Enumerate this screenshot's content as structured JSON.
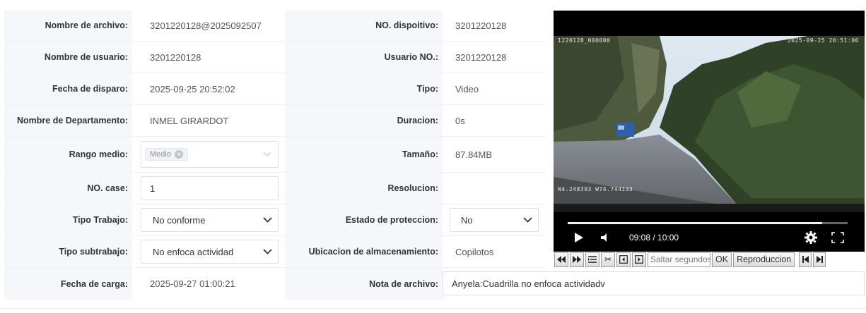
{
  "form": {
    "rows": [
      {
        "l_label": "Nombre de archivo:",
        "l_value": "3201220128@2025092507",
        "r_label": "NO. dispoitivo:",
        "r_value": "3201220128"
      },
      {
        "l_label": "Nombre de usuario:",
        "l_value": "3201220128",
        "r_label": "Usuario NO.:",
        "r_value": "3201220128"
      },
      {
        "l_label": "Fecha de disparo:",
        "l_value": "2025-09-25 20:52:02",
        "r_label": "Tipo:",
        "r_value": "Video"
      },
      {
        "l_label": "Nombre de Departamento:",
        "l_value": "INMEL GIRARDOT",
        "r_label": "Duracion:",
        "r_value": "0s"
      },
      {
        "l_label": "Rango medio:",
        "l_tag": "Medio",
        "r_label": "Tamaño:",
        "r_value": "87.84MB"
      },
      {
        "l_label": "NO. case:",
        "l_input": "1",
        "r_label": "Resolucion:",
        "r_value": ""
      },
      {
        "l_label": "Tipo Trabajo:",
        "l_select": "No conforme",
        "r_label": "Estado de proteccion:",
        "r_select": "No"
      },
      {
        "l_label": "Tipo subtrabajo:",
        "l_select": "No enfoca actividad",
        "r_label": "Ubicacion de almacenamiento:",
        "r_value": "Copilotos"
      },
      {
        "l_label": "Fecha de carga:",
        "l_value": "2025-09-27 01:00:21",
        "r_label": "Nota de archivo:",
        "r_note": "Anyela:Cuadrilla no enfoca actividadv"
      }
    ]
  },
  "video": {
    "osd_top_left": "1220128_000000",
    "osd_top_right": "2025-09-25 20:51:00",
    "osd_gps": "N4.248393 W74.744133",
    "time_current": "09:08",
    "time_total": "10:00",
    "time_display": "09:08 / 10:00",
    "progress_fraction": 0.908
  },
  "toolbar": {
    "seek_placeholder": "Saltar segundos",
    "ok_label": "OK",
    "play_label": "Reproduccion"
  },
  "icons": [
    "rewind-icon",
    "fast-forward-icon",
    "list-icon",
    "scissors-icon",
    "prev-frame-icon",
    "next-frame-icon",
    "first-icon",
    "last-icon",
    "play-icon",
    "volume-icon",
    "gear-icon",
    "fullscreen-icon",
    "chevron-down-icon",
    "tag-close-icon"
  ]
}
